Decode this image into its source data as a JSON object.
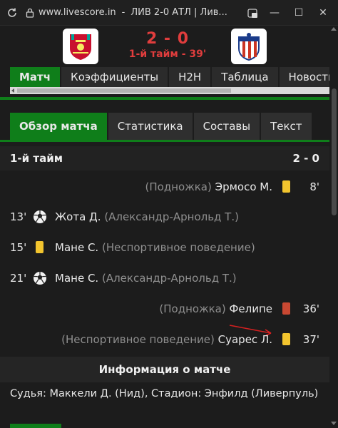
{
  "browser": {
    "url": "www.livescore.in",
    "title": "ЛИВ 2-0 АТЛ | Лив...",
    "icons": [
      "reload-icon",
      "lock-icon",
      "extension-icon",
      "minimize-icon",
      "maximize-icon",
      "close-icon"
    ],
    "window_buttons": {
      "minimize": "—",
      "maximize": "☐",
      "close": "✕"
    }
  },
  "match": {
    "home_team_icon": "liverpool-crest",
    "away_team_icon": "atletico-crest",
    "score": "2 - 0",
    "status": "1-й тайм - 39'"
  },
  "top_tabs": [
    {
      "label": "Матч",
      "active": true
    },
    {
      "label": "Коэффициенты",
      "active": false
    },
    {
      "label": "H2H",
      "active": false
    },
    {
      "label": "Таблица",
      "active": false
    },
    {
      "label": "Новости",
      "active": false
    }
  ],
  "sub_tabs": [
    {
      "label": "Обзор матча",
      "active": true
    },
    {
      "label": "Статистика",
      "active": false
    },
    {
      "label": "Составы",
      "active": false
    },
    {
      "label": "Текст",
      "active": false
    }
  ],
  "period": {
    "label": "1-й тайм",
    "score": "2 - 0"
  },
  "events": [
    {
      "side": "away",
      "minute": "8'",
      "icon": "yellow-card",
      "player": "Эрмосо М.",
      "detail": "(Подножка)"
    },
    {
      "side": "home",
      "minute": "13'",
      "icon": "goal-ball",
      "player": "Жота Д.",
      "detail": "(Александр-Арнольд Т.)"
    },
    {
      "side": "home",
      "minute": "15'",
      "icon": "yellow-card",
      "player": "Мане С.",
      "detail": "(Неспортивное поведение)"
    },
    {
      "side": "home",
      "minute": "21'",
      "icon": "goal-ball",
      "player": "Мане С.",
      "detail": "(Александр-Арнольд Т.)"
    },
    {
      "side": "away",
      "minute": "36'",
      "icon": "red-card",
      "player": "Фелипе",
      "detail": "(Подножка)"
    },
    {
      "side": "away",
      "minute": "37'",
      "icon": "yellow-card",
      "player": "Суарес Л.",
      "detail": "(Неспортивное поведение)"
    }
  ],
  "info": {
    "heading": "Информация о матче",
    "line": "Судья: Маккели Д. (Нид), Стадион: Энфилд (Ливерпуль)"
  },
  "colors": {
    "accent": "#0f7e1a",
    "score_red": "#e03d3d",
    "yellow_card": "#f2c42e",
    "red_card": "#c84832"
  }
}
